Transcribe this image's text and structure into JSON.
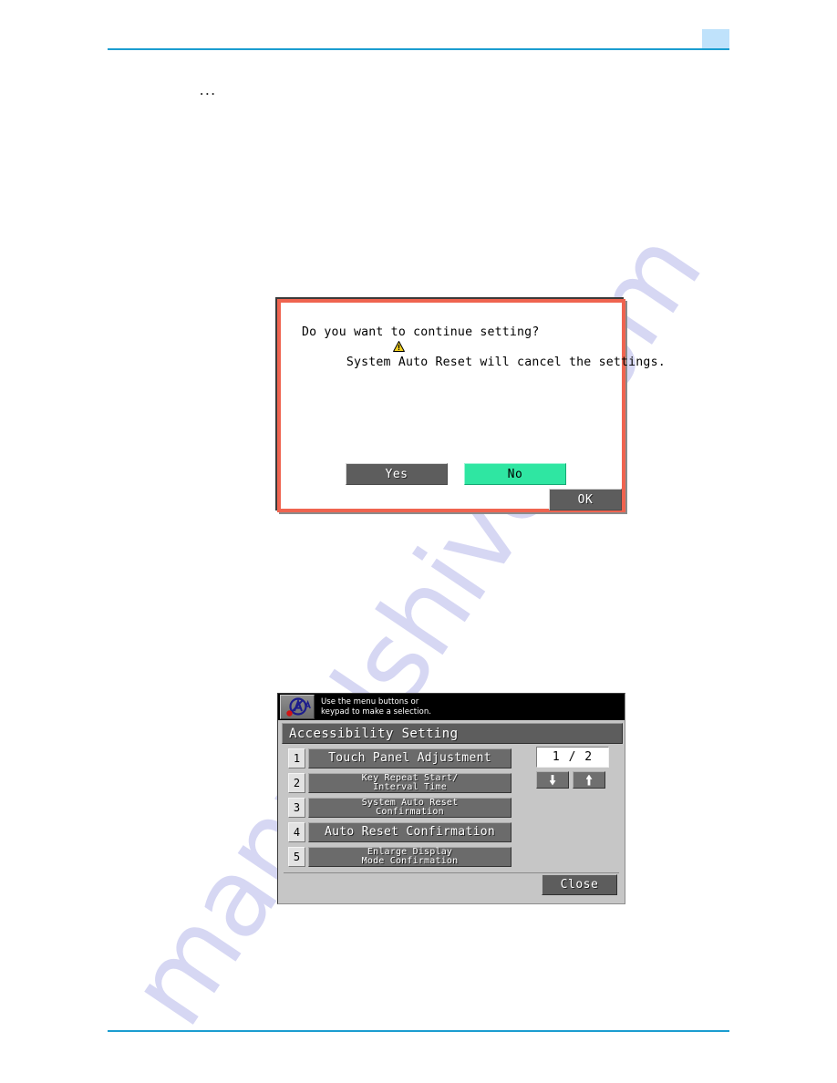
{
  "page": {
    "body_marker": "...",
    "watermark": "manualshive.com",
    "header_rule_color": "#1b9dd0",
    "header_tab_color": "#bfe2fb",
    "footer_rule_color": "#1b9dd0"
  },
  "confirm_dialog": {
    "border_color": "#ef6450",
    "warning_icon": "warning-triangle-icon",
    "message_line1": "System Auto Reset will cancel the settings.",
    "message_line2": "Do you want to continue setting?",
    "buttons": {
      "yes_label": "Yes",
      "no_label": "No",
      "ok_label": "OK"
    },
    "selected_button": "No",
    "selected_color": "#2fe6a2",
    "button_color": "#5d5d5d"
  },
  "accessibility_panel": {
    "status_icon": "accessibility-icon",
    "status_message": "Use the menu buttons or\nkeypad to make a selection.",
    "title": "Accessibility Setting",
    "menu_items": [
      {
        "number": "1",
        "label": "Touch Panel Adjustment",
        "lines": 1
      },
      {
        "number": "2",
        "label": "Key Repeat Start/\nInterval Time",
        "lines": 2
      },
      {
        "number": "3",
        "label": "System Auto Reset\nConfirmation",
        "lines": 2
      },
      {
        "number": "4",
        "label": "Auto Reset Confirmation",
        "lines": 1
      },
      {
        "number": "5",
        "label": "Enlarge Display\nMode Confirmation",
        "lines": 2
      }
    ],
    "pager": {
      "readout": "1 / 2",
      "down_icon": "arrow-down-icon",
      "up_icon": "arrow-up-icon"
    },
    "close_label": "Close"
  }
}
